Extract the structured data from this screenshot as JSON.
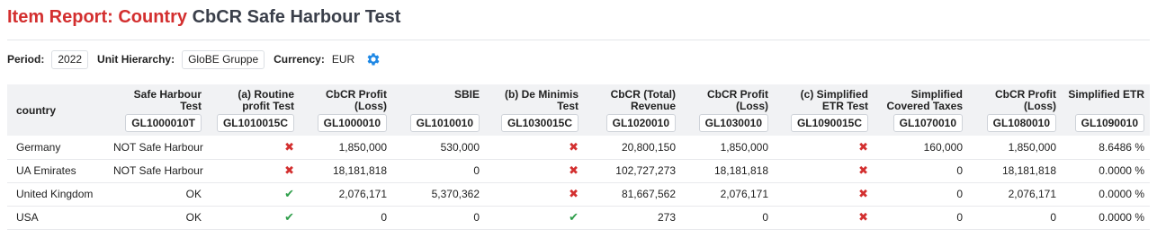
{
  "title": {
    "prefix": "Item Report: Country",
    "name": "CbCR Safe Harbour Test"
  },
  "filters": {
    "period_label": "Period:",
    "period_value": "2022",
    "hierarchy_label": "Unit Hierarchy:",
    "hierarchy_value": "GloBE Gruppe",
    "currency_label": "Currency:",
    "currency_value": "EUR",
    "settings_icon": "gear-icon"
  },
  "table": {
    "country_header": "country",
    "columns": [
      {
        "label": "Safe Harbour Test",
        "code": "GL1000010T"
      },
      {
        "label": "(a) Routine profit Test",
        "code": "GL1010015C"
      },
      {
        "label": "CbCR Profit (Loss)",
        "code": "GL1000010"
      },
      {
        "label": "SBIE",
        "code": "GL1010010"
      },
      {
        "label": "(b) De Minimis Test",
        "code": "GL1030015C"
      },
      {
        "label": "CbCR (Total) Revenue",
        "code": "GL1020010"
      },
      {
        "label": "CbCR Profit (Loss)",
        "code": "GL1030010"
      },
      {
        "label": "(c) Simplified ETR Test",
        "code": "GL1090015C"
      },
      {
        "label": "Simplified Covered Taxes",
        "code": "GL1070010"
      },
      {
        "label": "CbCR Profit (Loss)",
        "code": "GL1080010"
      },
      {
        "label": "Simplified ETR",
        "code": "GL1090010"
      }
    ],
    "rows": [
      {
        "country": "Germany",
        "safe_harbour": "NOT Safe Harbour",
        "routine_ok": false,
        "profit_a": "1,850,000",
        "sbie": "530,000",
        "deminimis_ok": false,
        "revenue": "20,800,150",
        "profit_b": "1,850,000",
        "etr_ok": false,
        "covered_taxes": "160,000",
        "profit_c": "1,850,000",
        "etr": "8.6486 %"
      },
      {
        "country": "UA Emirates",
        "safe_harbour": "NOT Safe Harbour",
        "routine_ok": false,
        "profit_a": "18,181,818",
        "sbie": "0",
        "deminimis_ok": false,
        "revenue": "102,727,273",
        "profit_b": "18,181,818",
        "etr_ok": false,
        "covered_taxes": "0",
        "profit_c": "18,181,818",
        "etr": "0.0000 %"
      },
      {
        "country": "United Kingdom",
        "safe_harbour": "OK",
        "routine_ok": true,
        "profit_a": "2,076,171",
        "sbie": "5,370,362",
        "deminimis_ok": false,
        "revenue": "81,667,562",
        "profit_b": "2,076,171",
        "etr_ok": false,
        "covered_taxes": "0",
        "profit_c": "2,076,171",
        "etr": "0.0000 %"
      },
      {
        "country": "USA",
        "safe_harbour": "OK",
        "routine_ok": true,
        "profit_a": "0",
        "sbie": "0",
        "deminimis_ok": true,
        "revenue": "273",
        "profit_b": "0",
        "etr_ok": false,
        "covered_taxes": "0",
        "profit_c": "0",
        "etr": "0.0000 %"
      }
    ]
  },
  "colors": {
    "title_accent": "#d32f2f",
    "title_main": "#3a3f4a",
    "fail": "#d32f2f",
    "pass": "#2e9e4a",
    "settings_icon": "#1e88e5",
    "header_bg": "#f1f2f4"
  }
}
